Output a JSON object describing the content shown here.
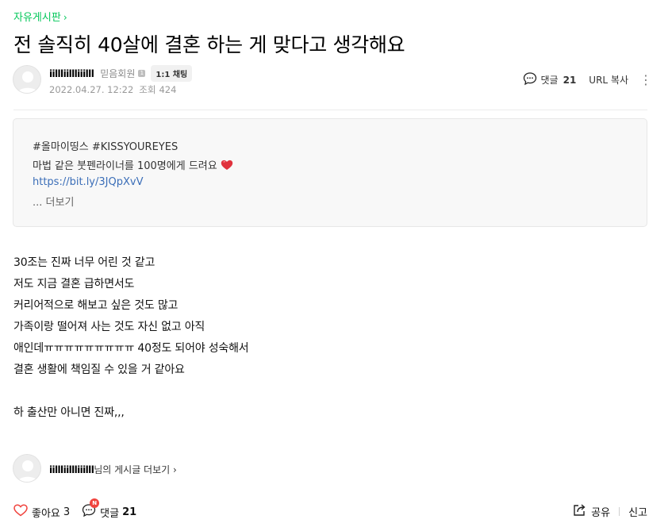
{
  "board": {
    "name": "자유게시판",
    "chevron": "›"
  },
  "post": {
    "title": "전 솔직히 40살에 결혼 하는 게 맞다고 생각해요",
    "author": "iillliillliiilll",
    "member_grade": "믿음회원",
    "grade_badge": "1",
    "chat_button": "1:1 채팅",
    "date": "2022.04.27. 12:22",
    "views_label": "조회",
    "views": "424"
  },
  "tools": {
    "comment_label": "댓글",
    "comment_count": "21",
    "url_copy": "URL 복사",
    "more_icon": "⋮"
  },
  "promo": {
    "hashtags": "#올마이띵스 #KISSYOUREYES",
    "headline": "마법 같은 붓펜라이너를 100명에게 드려요",
    "heart_icon": "heart-emoji",
    "link": "https://bit.ly/3JQpXvV",
    "more": "... 더보기"
  },
  "body": {
    "lines": [
      "30조는 진짜 너무 어린 것 같고",
      "저도 지금 결혼 급하면서도",
      "커리어적으로 해보고 싶은 것도 많고",
      "가족이랑 떨어져 사는 것도 자신 없고 아직",
      "애인데ㅠㅠㅠㅠㅠㅠㅠㅠㅠ 40정도 되어야 성숙해서",
      "결혼 생활에 책임질 수 있을 거 같아요",
      "하 출산만 아니면 진짜,,,"
    ]
  },
  "author_posts": {
    "name": "iillliillliiilll",
    "suffix": "님의 게시글 더보기 ›"
  },
  "footer": {
    "like_label": "좋아요",
    "like_count": "3",
    "new_badge": "N",
    "comment_label": "댓글",
    "comment_count": "21",
    "share_label": "공유",
    "report_label": "신고"
  },
  "colors": {
    "accent_green": "#03c75a",
    "link_blue": "#3b6eb8",
    "badge_red": "#f0443e"
  }
}
